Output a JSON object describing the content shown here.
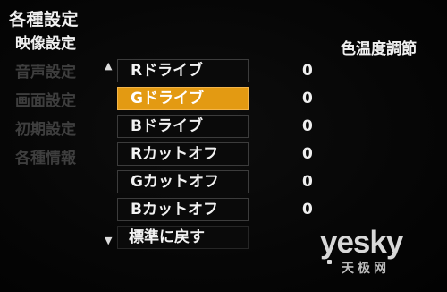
{
  "menu_title": "各種設定",
  "left_menu": [
    {
      "label": "映像設定",
      "active": true
    },
    {
      "label": "音声設定",
      "active": false
    },
    {
      "label": "画面設定",
      "active": false
    },
    {
      "label": "初期設定",
      "active": false
    },
    {
      "label": "各種情報",
      "active": false
    }
  ],
  "page_header": "色温度調節",
  "options": [
    {
      "label": "Rドライブ",
      "value": "0"
    },
    {
      "label": "Gドライブ",
      "value": "0",
      "selected": true
    },
    {
      "label": "Bドライブ",
      "value": "0"
    },
    {
      "label": "Rカットオフ",
      "value": "0"
    },
    {
      "label": "Gカットオフ",
      "value": "0"
    },
    {
      "label": "Bカットオフ",
      "value": "0"
    }
  ],
  "reset_label": "標準に戻す",
  "scroll_up_symbol": "▲",
  "scroll_down_symbol": "▼",
  "watermark": {
    "main": "yesky",
    "sub": "天极网"
  },
  "colors": {
    "selected_bg": "#e39a12",
    "active_text": "#f0f0f0",
    "inactive_text": "#3e3e3e",
    "background": "#050505"
  }
}
